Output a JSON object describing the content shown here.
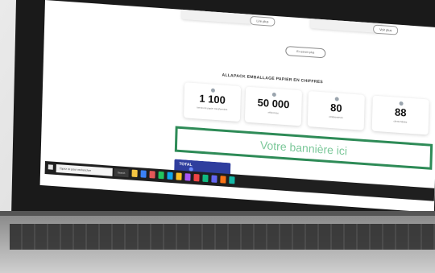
{
  "page": {
    "headline": "ALLAPACK EMBALLAGE PAPIER EN CHIFFRES",
    "top_button_left": "Lire plus",
    "top_button_right": "Voir plus",
    "center_button": "En savoir plus"
  },
  "stats": [
    {
      "value": "1 100",
      "label": "tonnes de papier transformées"
    },
    {
      "value": "50 000",
      "label": "références"
    },
    {
      "value": "80",
      "label": "collaborateurs"
    },
    {
      "value": "88",
      "label": "clients fidèles"
    }
  ],
  "banner": {
    "text": "Votre bannière ici"
  },
  "taskbar": {
    "search_placeholder": "Tapez ici pour rechercher",
    "search_button": "Search",
    "icons": [
      "file-explorer-icon",
      "store-icon",
      "mail-icon",
      "edge-icon",
      "chrome-icon",
      "photos-icon",
      "settings-icon",
      "app-icon",
      "app-icon",
      "app-icon",
      "app-icon",
      "app-icon"
    ],
    "icon_colors": [
      "#f5c542",
      "#3b82f6",
      "#e45858",
      "#22c55e",
      "#0ea5e9",
      "#fbbf24",
      "#a855f7",
      "#ef4444",
      "#10b981",
      "#6366f1",
      "#f97316",
      "#14b8a6"
    ]
  },
  "promo": {
    "logo": "TOTAL"
  },
  "colors": {
    "banner_border": "#2e8b57",
    "banner_text": "#7cc89a",
    "promo_bg": "#2f3e9e"
  }
}
